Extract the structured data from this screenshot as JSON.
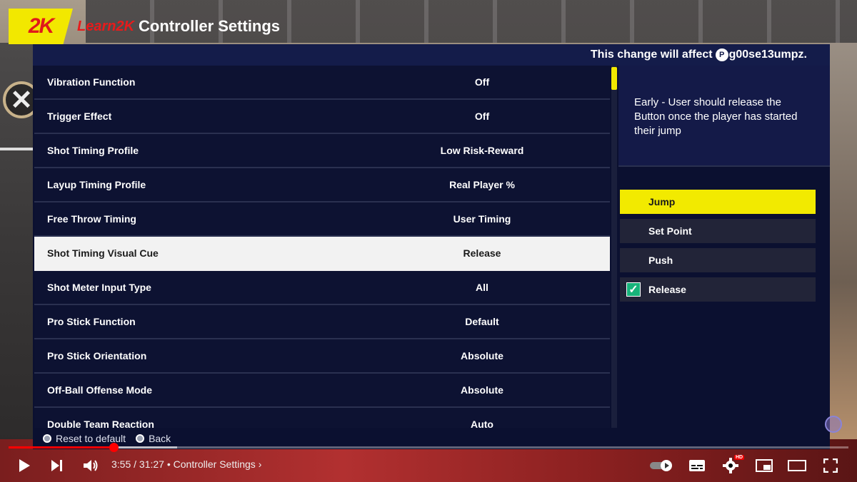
{
  "header": {
    "logo": "2K",
    "brand": "Learn2K",
    "title": "Controller Settings"
  },
  "affect_bar": {
    "prefix": "This change will affect",
    "account": "g00se13umpz."
  },
  "settings": [
    {
      "label": "Vibration Function",
      "value": "Off",
      "selected": false
    },
    {
      "label": "Trigger Effect",
      "value": "Off",
      "selected": false
    },
    {
      "label": "Shot Timing Profile",
      "value": "Low Risk-Reward",
      "selected": false
    },
    {
      "label": "Layup Timing Profile",
      "value": "Real Player %",
      "selected": false
    },
    {
      "label": "Free Throw Timing",
      "value": "User Timing",
      "selected": false
    },
    {
      "label": "Shot Timing Visual Cue",
      "value": "Release",
      "selected": true
    },
    {
      "label": "Shot Meter Input Type",
      "value": "All",
      "selected": false
    },
    {
      "label": "Pro Stick Function",
      "value": "Default",
      "selected": false
    },
    {
      "label": "Pro Stick Orientation",
      "value": "Absolute",
      "selected": false
    },
    {
      "label": "Off-Ball Offense Mode",
      "value": "Absolute",
      "selected": false
    },
    {
      "label": "Double Team Reaction",
      "value": "Auto",
      "selected": false
    }
  ],
  "description": "Early - User should release the Button once the player has started their jump",
  "options": [
    {
      "label": "Jump",
      "highlighted": true,
      "checked": false
    },
    {
      "label": "Set Point",
      "highlighted": false,
      "checked": false
    },
    {
      "label": "Push",
      "highlighted": false,
      "checked": false
    },
    {
      "label": "Release",
      "highlighted": false,
      "checked": true
    }
  ],
  "footer": {
    "reset_label": "Reset to default",
    "back_label": "Back"
  },
  "player": {
    "time": "3:55 / 31:27",
    "chapter": "• Controller Settings",
    "chapter_chevron": "›",
    "hd_badge": "HD",
    "progress_fraction": 0.125
  },
  "colors": {
    "accent_yellow": "#f2ea00",
    "panel_bg": "#0b1030",
    "youtube_red": "#ff0000"
  }
}
